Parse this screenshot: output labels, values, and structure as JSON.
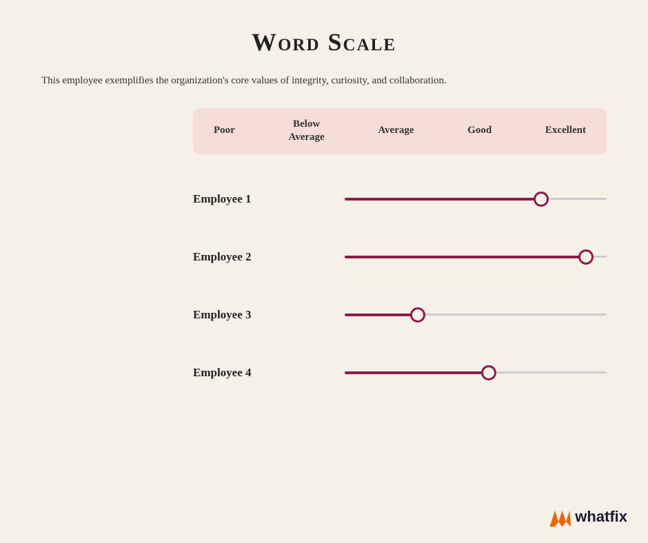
{
  "page": {
    "title": "Word Scale",
    "description": "This employee exemplifies the organization's core values of integrity, curiosity, and collaboration.",
    "background_color": "#f5f0e8"
  },
  "scale": {
    "labels": [
      "Poor",
      "Below Average",
      "Average",
      "Good",
      "Excellent"
    ],
    "header_bg": "#f5ddd8"
  },
  "employees": [
    {
      "name": "Employee 1",
      "label": "Employee 1",
      "value_pct": 75
    },
    {
      "name": "Employee 2",
      "label": "Employee 2",
      "value_pct": 92
    },
    {
      "name": "Employee 3",
      "label": "Employee 3",
      "value_pct": 28
    },
    {
      "name": "Employee 4",
      "label": "Employee 4",
      "value_pct": 55
    }
  ],
  "brand": {
    "name": "whatfix",
    "icon_color": "#e8650a"
  }
}
